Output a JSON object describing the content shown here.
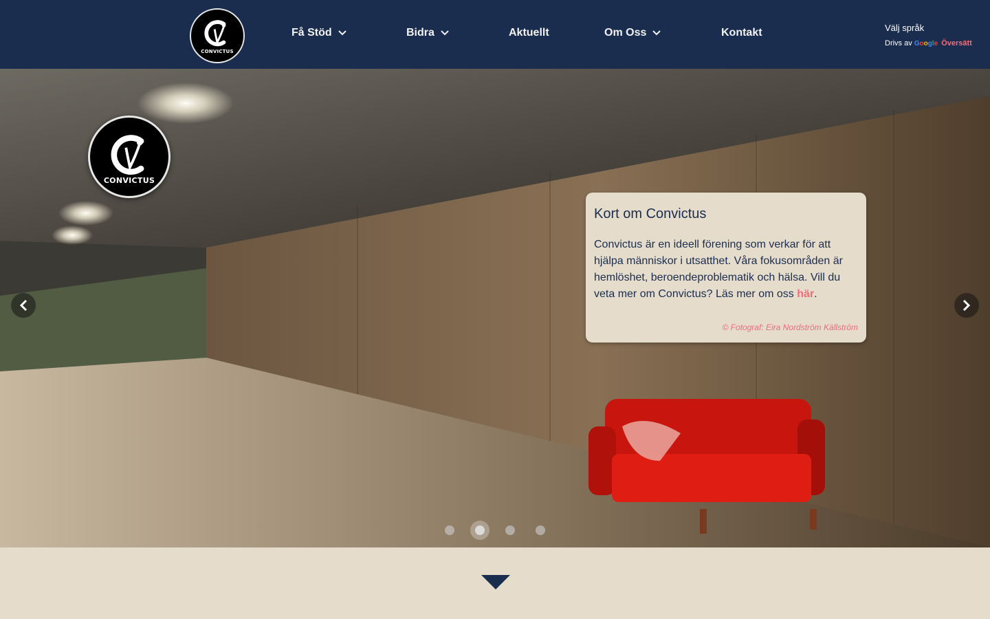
{
  "brand": {
    "logo_text": "CONVICTUS",
    "logo_glyph": "C",
    "logo_glyph_secondary": "V"
  },
  "nav": {
    "items": [
      {
        "label": "Få Stöd",
        "has_dropdown": true
      },
      {
        "label": "Bidra",
        "has_dropdown": true
      },
      {
        "label": "Aktuellt",
        "has_dropdown": false
      },
      {
        "label": "Om Oss",
        "has_dropdown": true
      },
      {
        "label": "Kontakt",
        "has_dropdown": false
      }
    ]
  },
  "language": {
    "label": "Välj språk",
    "powered_by": "Drivs av",
    "google": [
      "G",
      "o",
      "o",
      "g",
      "l",
      "e"
    ],
    "translate": "Översätt"
  },
  "hero": {
    "card": {
      "title": "Kort om Convictus",
      "body": "Convictus är en ideell förening som verkar för att hjälpa människor i utsatthet. Våra fokusområden är hemlöshet, beroendeproblematik och hälsa. Vill du veta mer om Convictus? Läs mer om oss ",
      "link": "här",
      "after_link": ".",
      "credit": "© Fotograf: Eira Nordström Källström"
    },
    "carousel": {
      "slide_count": 4,
      "active_slide": 2
    }
  },
  "colors": {
    "header_bg": "#1b2d4f",
    "accent": "#f26c7a",
    "card_bg": "#e5dccb"
  },
  "icons": {
    "prev": "chevron-left-icon",
    "next": "chevron-right-icon",
    "dropdown": "chevron-down-icon",
    "scroll": "triangle-down-icon"
  }
}
